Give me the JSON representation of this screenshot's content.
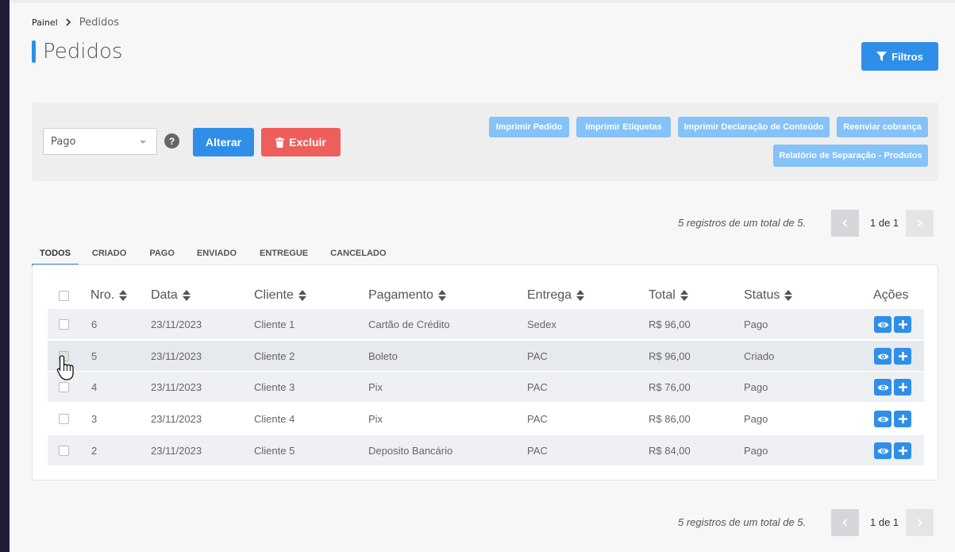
{
  "breadcrumb": {
    "home": "Painel",
    "current": "Pedidos"
  },
  "page": {
    "title": "Pedidos"
  },
  "filter_button": {
    "label": "Filtros"
  },
  "toolbar": {
    "status_select": {
      "value": "Pago"
    },
    "help": "?",
    "alterar": "Alterar",
    "excluir": "Excluir",
    "actions": [
      "Imprimir Pedido",
      "Imprimir Etiquetas",
      "Imprimir Declaração de Conteúdo",
      "Reenviar cobrança",
      "Relatório de Separação - Produtos"
    ]
  },
  "pagination": {
    "info": "5 registros de um total de 5.",
    "page": "1 de 1"
  },
  "tabs": [
    "TODOS",
    "CRIADO",
    "PAGO",
    "ENVIADO",
    "ENTREGUE",
    "CANCELADO"
  ],
  "table": {
    "headers": {
      "nro": "Nro.",
      "data": "Data",
      "cliente": "Cliente",
      "pagamento": "Pagamento",
      "entrega": "Entrega",
      "total": "Total",
      "status": "Status",
      "acoes": "Ações"
    },
    "rows": [
      {
        "nro": "6",
        "data": "23/11/2023",
        "cliente": "Cliente 1",
        "pagamento": "Cartão de Crédito",
        "entrega": "Sedex",
        "total": "R$ 96,00",
        "status": "Pago"
      },
      {
        "nro": "5",
        "data": "23/11/2023",
        "cliente": "Cliente 2",
        "pagamento": "Boleto",
        "entrega": "PAC",
        "total": "R$ 96,00",
        "status": "Criado"
      },
      {
        "nro": "4",
        "data": "23/11/2023",
        "cliente": "Cliente 3",
        "pagamento": "Pix",
        "entrega": "PAC",
        "total": "R$ 76,00",
        "status": "Pago"
      },
      {
        "nro": "3",
        "data": "23/11/2023",
        "cliente": "Cliente 4",
        "pagamento": "Pix",
        "entrega": "PAC",
        "total": "R$ 86,00",
        "status": "Pago"
      },
      {
        "nro": "2",
        "data": "23/11/2023",
        "cliente": "Cliente 5",
        "pagamento": "Deposito Bancário",
        "entrega": "PAC",
        "total": "R$ 84,00",
        "status": "Pago"
      }
    ]
  },
  "colors": {
    "primary": "#2f8fe8",
    "danger": "#ee5f5b",
    "light_primary": "#84c2f7"
  }
}
